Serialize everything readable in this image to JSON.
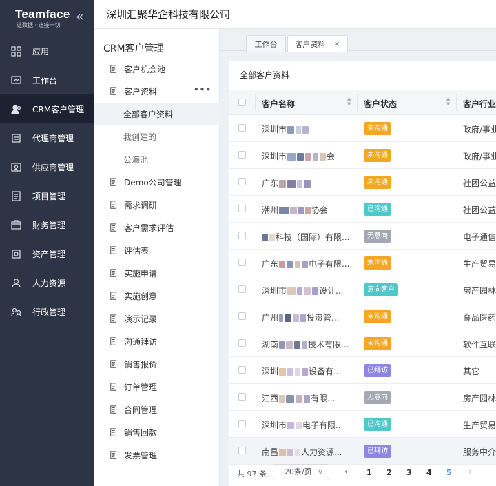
{
  "brand": {
    "name": "Teamface",
    "slogan": "让数据 · 连接一切"
  },
  "company": "深圳汇聚华企科技有限公司",
  "nav": [
    {
      "label": "应用",
      "icon": "apps-icon"
    },
    {
      "label": "工作台",
      "icon": "workbench-icon"
    },
    {
      "label": "CRM客户管理",
      "icon": "users-icon",
      "active": true
    },
    {
      "label": "代理商管理",
      "icon": "agent-icon"
    },
    {
      "label": "供应商管理",
      "icon": "supplier-icon"
    },
    {
      "label": "项目管理",
      "icon": "project-icon"
    },
    {
      "label": "财务管理",
      "icon": "finance-icon"
    },
    {
      "label": "资产管理",
      "icon": "asset-icon"
    },
    {
      "label": "人力资源",
      "icon": "hr-icon"
    },
    {
      "label": "行政管理",
      "icon": "admin-icon"
    }
  ],
  "submenu": {
    "title": "CRM客户管理",
    "items": [
      {
        "label": "客户机会池"
      },
      {
        "label": "客户资料"
      },
      {
        "label": "全部客户资料"
      },
      {
        "label": "我创建的"
      },
      {
        "label": "公海池"
      },
      {
        "label": "Demo公司管理"
      },
      {
        "label": "需求调研"
      },
      {
        "label": "客户需求评估"
      },
      {
        "label": "评估表"
      },
      {
        "label": "实施申请"
      },
      {
        "label": "实施创意"
      },
      {
        "label": "演示记录"
      },
      {
        "label": "沟通拜访"
      },
      {
        "label": "销售报价"
      },
      {
        "label": "订单管理"
      },
      {
        "label": "合同管理"
      },
      {
        "label": "销售回款"
      },
      {
        "label": "发票管理"
      }
    ]
  },
  "tabs": [
    {
      "label": "工作台"
    },
    {
      "label": "客户资料",
      "close": "×"
    }
  ],
  "panel": {
    "title": "全部客户资料"
  },
  "table": {
    "columns": [
      "客户名称",
      "客户状态",
      "客户行业"
    ],
    "rows": [
      {
        "pre": "深圳市",
        "post": "",
        "status": "未沟通",
        "industry": "政府/事业"
      },
      {
        "pre": "深圳市",
        "post": "会",
        "status": "未沟通",
        "industry": "政府/事业"
      },
      {
        "pre": "广东",
        "post": "",
        "status": "未沟通",
        "industry": "社团公益"
      },
      {
        "pre": "潮州",
        "post": "协会",
        "status": "已沟通",
        "industry": "社团公益"
      },
      {
        "pre": "",
        "post": "科技（国际）有限...",
        "status": "无意向",
        "industry": "电子通信"
      },
      {
        "pre": "广东",
        "post": "电子有限...",
        "status": "未沟通",
        "industry": "生产贸易"
      },
      {
        "pre": "深圳市",
        "post": "设计...",
        "status": "意向客户",
        "industry": "房产园林"
      },
      {
        "pre": "广州",
        "post": "投资管...",
        "status": "未沟通",
        "industry": "食品医药"
      },
      {
        "pre": "湖南",
        "post": "技术有限...",
        "status": "未沟通",
        "industry": "软件互联"
      },
      {
        "pre": "深圳",
        "post": "设备有...",
        "status": "已拜访",
        "industry": "其它"
      },
      {
        "pre": "江西",
        "post": "有限...",
        "status": "无意向",
        "industry": "房产园林"
      },
      {
        "pre": "深圳市",
        "post": "电子有限...",
        "status": "已沟通",
        "industry": "生产贸易"
      },
      {
        "pre": "南昌",
        "post": "人力资源...",
        "status": "已拜访",
        "industry": "服务中介"
      }
    ]
  },
  "status_colors": {
    "未沟通": "#f5a623",
    "已沟通": "#4fc8cc",
    "无意向": "#a3a8b3",
    "意向客户": "#4fc8cc",
    "已拜访": "#8e86e0"
  },
  "pagination": {
    "total": "共 97 条",
    "page_size": "20条/页",
    "prev": "‹",
    "next": "›",
    "pages": [
      "1",
      "2",
      "3",
      "4",
      "5"
    ],
    "current": "5"
  }
}
